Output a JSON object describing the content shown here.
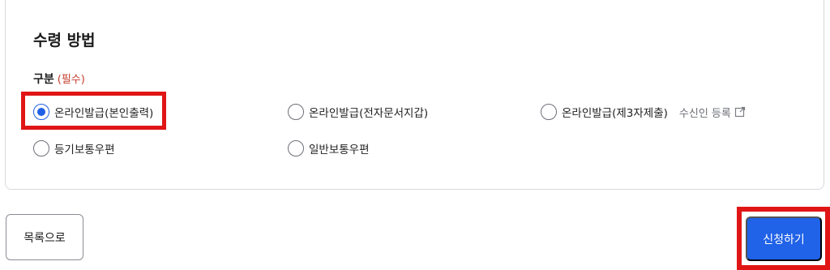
{
  "section": {
    "title": "수령 방법",
    "field_label": "구분",
    "required_text": "(필수)"
  },
  "options": [
    {
      "label": "온라인발급(본인출력)",
      "checked": true
    },
    {
      "label": "온라인발급(전자문서지갑)",
      "checked": false
    },
    {
      "label": "온라인발급(제3자제출)",
      "checked": false,
      "link": "수신인 등록",
      "link_icon": "external-link-icon"
    },
    {
      "label": "등기보통우편",
      "checked": false
    },
    {
      "label": "일반보통우편",
      "checked": false
    }
  ],
  "buttons": {
    "list": "목록으로",
    "apply": "신청하기"
  },
  "colors": {
    "primary": "#2062e8",
    "required": "#c43b2b",
    "highlight": "#e01616"
  }
}
